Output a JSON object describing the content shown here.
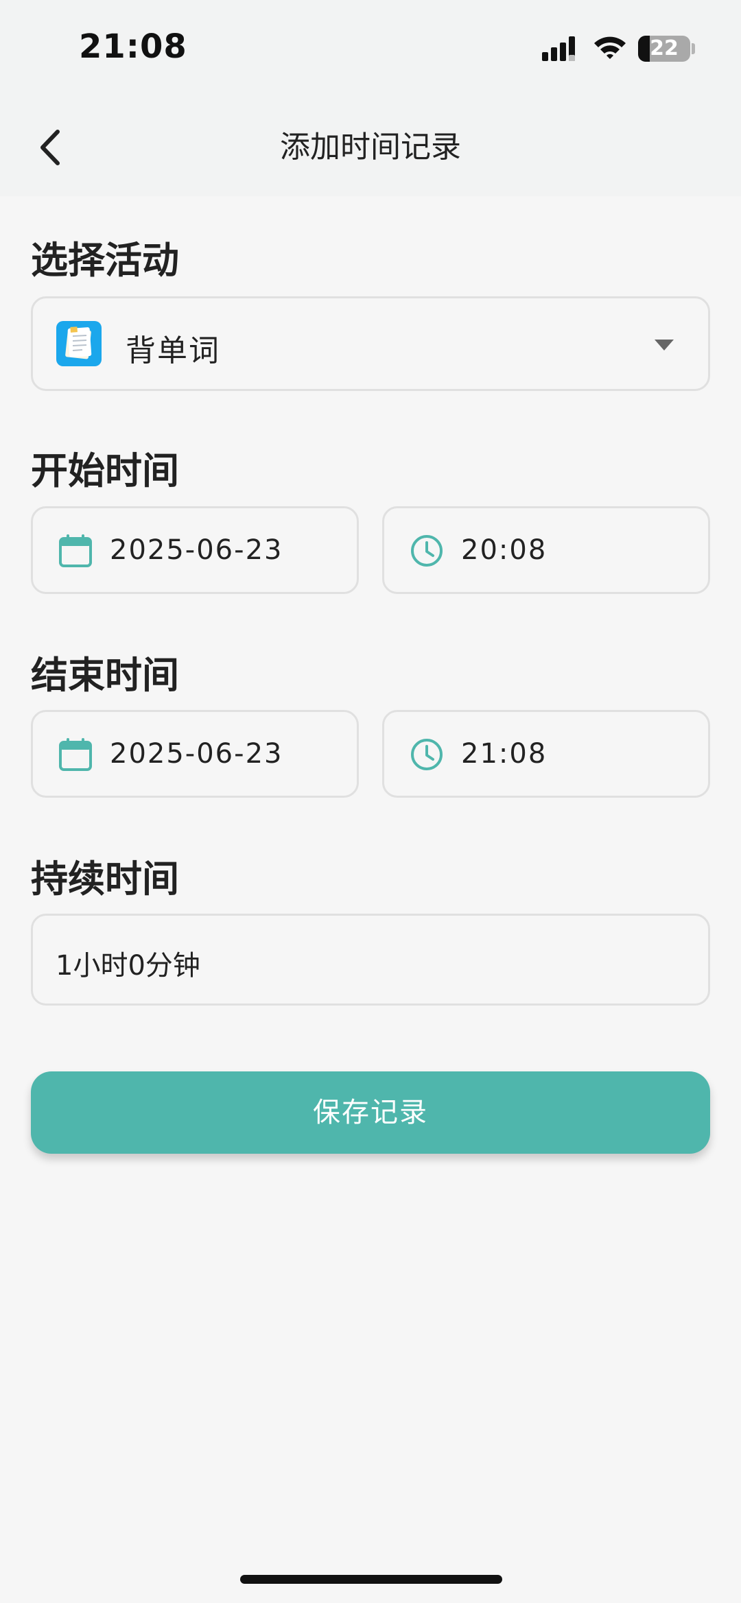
{
  "status_bar": {
    "time": "21:08",
    "battery": "22"
  },
  "header": {
    "title": "添加时间记录"
  },
  "activity": {
    "label": "选择活动",
    "selected": "背单词",
    "icon": "notepad-icon"
  },
  "start": {
    "label": "开始时间",
    "date": "2025-06-23",
    "time": "20:08"
  },
  "end": {
    "label": "结束时间",
    "date": "2025-06-23",
    "time": "21:08"
  },
  "duration": {
    "label": "持续时间",
    "value": "1小时0分钟"
  },
  "actions": {
    "save_label": "保存记录"
  },
  "colors": {
    "accent": "#4fb6ac",
    "background": "#f6f6f6",
    "field_border": "#e0e0e0"
  }
}
